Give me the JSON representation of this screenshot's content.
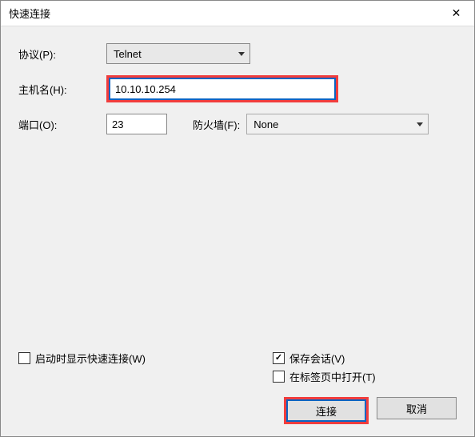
{
  "title": "快速连接",
  "labels": {
    "protocol": "协议(P):",
    "hostname": "主机名(H):",
    "port": "端口(O):",
    "firewall": "防火墙(F):"
  },
  "values": {
    "protocol": "Telnet",
    "hostname": "10.10.10.254",
    "port": "23",
    "firewall": "None"
  },
  "checkboxes": {
    "show_on_start": "启动时显示快速连接(W)",
    "save_session": "保存会话(V)",
    "open_in_tab": "在标签页中打开(T)"
  },
  "buttons": {
    "connect": "连接",
    "cancel": "取消"
  }
}
